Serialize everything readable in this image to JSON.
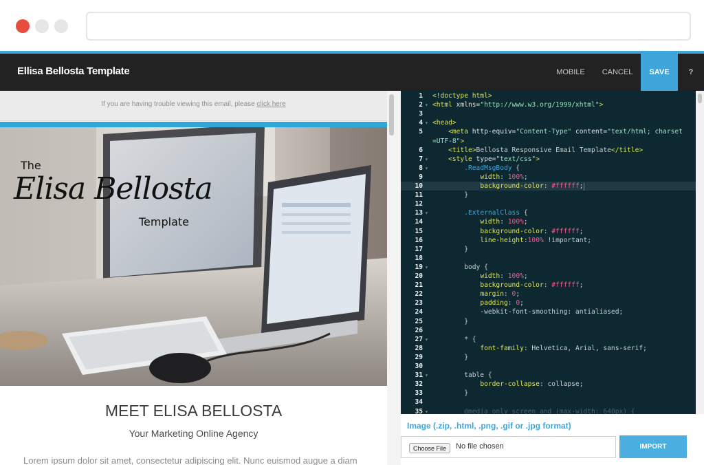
{
  "header": {
    "app_title": "Ellisa Bellosta Template",
    "nav": {
      "mobile": "MOBILE",
      "cancel": "CANCEL",
      "save": "SAVE",
      "help": "?"
    }
  },
  "preview": {
    "trouble_text": "If you are having trouble viewing this email, please",
    "trouble_link": "click here",
    "hero_logo": {
      "small_top": "The",
      "script": "Elisa Bellosta",
      "small_bottom": "Template"
    },
    "heading": "MEET ELISA BELLOSTA",
    "subheading": "Your Marketing Online Agency",
    "body_text": "Lorem ipsum dolor sit amet, consectetur adipiscing elit. Nunc euismod augue a diam"
  },
  "editor": {
    "active_line": 10,
    "lines": [
      {
        "n": "1",
        "fold": false,
        "tokens": [
          [
            "tag",
            "<!doctype html>"
          ]
        ]
      },
      {
        "n": "2",
        "fold": true,
        "tokens": [
          [
            "tag",
            "<html "
          ],
          [
            "attr",
            "xmlns="
          ],
          [
            "str",
            "\"http://www.w3.org/1999/xhtml\""
          ],
          [
            "tag",
            ">"
          ]
        ]
      },
      {
        "n": "3",
        "fold": false,
        "tokens": []
      },
      {
        "n": "4",
        "fold": true,
        "tokens": [
          [
            "tag",
            "<head>"
          ]
        ]
      },
      {
        "n": "5",
        "fold": false,
        "tokens": [
          [
            "plain",
            "    "
          ],
          [
            "tag",
            "<meta "
          ],
          [
            "attr",
            "http-equiv="
          ],
          [
            "str",
            "\"Content-Type\""
          ],
          [
            "attr",
            " content="
          ],
          [
            "str",
            "\"text/html; charset"
          ]
        ]
      },
      {
        "n": "",
        "fold": false,
        "tokens": [
          [
            "str",
            "=UTF-8\""
          ],
          [
            "tag",
            ">"
          ]
        ]
      },
      {
        "n": "6",
        "fold": false,
        "tokens": [
          [
            "plain",
            "    "
          ],
          [
            "tag",
            "<title>"
          ],
          [
            "plain",
            "Bellosta Responsive Email Template"
          ],
          [
            "tag",
            "</title>"
          ]
        ]
      },
      {
        "n": "7",
        "fold": true,
        "tokens": [
          [
            "plain",
            "    "
          ],
          [
            "tag",
            "<style "
          ],
          [
            "attr",
            "type="
          ],
          [
            "str",
            "\"text/css\""
          ],
          [
            "tag",
            ">"
          ]
        ]
      },
      {
        "n": "8",
        "fold": true,
        "tokens": [
          [
            "plain",
            "        "
          ],
          [
            "sel",
            ".ReadMsgBody"
          ],
          [
            "plain",
            " {"
          ]
        ]
      },
      {
        "n": "9",
        "fold": false,
        "tokens": [
          [
            "plain",
            "            "
          ],
          [
            "prop",
            "width"
          ],
          [
            "plain",
            ": "
          ],
          [
            "val",
            "100%"
          ],
          [
            "plain",
            ";"
          ]
        ]
      },
      {
        "n": "10",
        "fold": false,
        "tokens": [
          [
            "plain",
            "            "
          ],
          [
            "prop",
            "background-color"
          ],
          [
            "plain",
            ": "
          ],
          [
            "val",
            "#ffffff"
          ],
          [
            "plain",
            ";"
          ]
        ]
      },
      {
        "n": "11",
        "fold": false,
        "tokens": [
          [
            "plain",
            "        }"
          ]
        ]
      },
      {
        "n": "12",
        "fold": false,
        "tokens": []
      },
      {
        "n": "13",
        "fold": true,
        "tokens": [
          [
            "plain",
            "        "
          ],
          [
            "sel",
            ".ExternalClass"
          ],
          [
            "plain",
            " {"
          ]
        ]
      },
      {
        "n": "14",
        "fold": false,
        "tokens": [
          [
            "plain",
            "            "
          ],
          [
            "prop",
            "width"
          ],
          [
            "plain",
            ": "
          ],
          [
            "val",
            "100%"
          ],
          [
            "plain",
            ";"
          ]
        ]
      },
      {
        "n": "15",
        "fold": false,
        "tokens": [
          [
            "plain",
            "            "
          ],
          [
            "prop",
            "background-color"
          ],
          [
            "plain",
            ": "
          ],
          [
            "val",
            "#ffffff"
          ],
          [
            "plain",
            ";"
          ]
        ]
      },
      {
        "n": "16",
        "fold": false,
        "tokens": [
          [
            "plain",
            "            "
          ],
          [
            "prop",
            "line-height"
          ],
          [
            "plain",
            ":"
          ],
          [
            "val",
            "100%"
          ],
          [
            "plain",
            " !important;"
          ]
        ]
      },
      {
        "n": "17",
        "fold": false,
        "tokens": [
          [
            "plain",
            "        }"
          ]
        ]
      },
      {
        "n": "18",
        "fold": false,
        "tokens": []
      },
      {
        "n": "19",
        "fold": true,
        "tokens": [
          [
            "plain",
            "        body {"
          ]
        ]
      },
      {
        "n": "20",
        "fold": false,
        "tokens": [
          [
            "plain",
            "            "
          ],
          [
            "prop",
            "width"
          ],
          [
            "plain",
            ": "
          ],
          [
            "val",
            "100%"
          ],
          [
            "plain",
            ";"
          ]
        ]
      },
      {
        "n": "21",
        "fold": false,
        "tokens": [
          [
            "plain",
            "            "
          ],
          [
            "prop",
            "background-color"
          ],
          [
            "plain",
            ": "
          ],
          [
            "val",
            "#ffffff"
          ],
          [
            "plain",
            ";"
          ]
        ]
      },
      {
        "n": "22",
        "fold": false,
        "tokens": [
          [
            "plain",
            "            "
          ],
          [
            "prop",
            "margin"
          ],
          [
            "plain",
            ": "
          ],
          [
            "val",
            "0"
          ],
          [
            "plain",
            ";"
          ]
        ]
      },
      {
        "n": "23",
        "fold": false,
        "tokens": [
          [
            "plain",
            "            "
          ],
          [
            "prop",
            "padding"
          ],
          [
            "plain",
            ": "
          ],
          [
            "val",
            "0"
          ],
          [
            "plain",
            ";"
          ]
        ]
      },
      {
        "n": "24",
        "fold": false,
        "tokens": [
          [
            "plain",
            "            -webkit-font-smoothing: antialiased;"
          ]
        ]
      },
      {
        "n": "25",
        "fold": false,
        "tokens": [
          [
            "plain",
            "        }"
          ]
        ]
      },
      {
        "n": "26",
        "fold": false,
        "tokens": []
      },
      {
        "n": "27",
        "fold": true,
        "tokens": [
          [
            "plain",
            "        * {"
          ]
        ]
      },
      {
        "n": "28",
        "fold": false,
        "tokens": [
          [
            "plain",
            "            "
          ],
          [
            "prop",
            "font-family"
          ],
          [
            "plain",
            ": Helvetica, Arial, sans-serif;"
          ]
        ]
      },
      {
        "n": "29",
        "fold": false,
        "tokens": [
          [
            "plain",
            "        }"
          ]
        ]
      },
      {
        "n": "30",
        "fold": false,
        "tokens": []
      },
      {
        "n": "31",
        "fold": true,
        "tokens": [
          [
            "plain",
            "        table {"
          ]
        ]
      },
      {
        "n": "32",
        "fold": false,
        "tokens": [
          [
            "plain",
            "            "
          ],
          [
            "prop",
            "border-collapse"
          ],
          [
            "plain",
            ": collapse;"
          ]
        ]
      },
      {
        "n": "33",
        "fold": false,
        "tokens": [
          [
            "plain",
            "        }"
          ]
        ]
      },
      {
        "n": "34",
        "fold": false,
        "tokens": []
      },
      {
        "n": "35",
        "fold": true,
        "tokens": [
          [
            "cmt",
            "        @media only screen and (max-width: 640px) {"
          ]
        ]
      }
    ]
  },
  "import": {
    "label": "Image (.zip, .html, .png, .gif or .jpg format)",
    "choose_button": "Choose File",
    "no_file": "No file chosen",
    "import_button": "IMPORT"
  },
  "colors": {
    "accent": "#3fa6dc",
    "header_bg": "#222222",
    "editor_bg": "#0d2831",
    "close_dot": "#e74c3c"
  }
}
